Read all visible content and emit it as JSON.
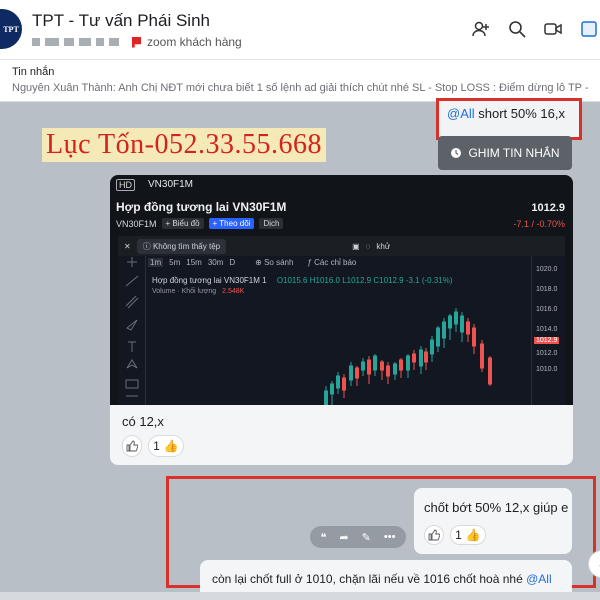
{
  "header": {
    "avatar_text": "TPT",
    "title": "TPT - Tư vấn Phái Sinh",
    "subtitle_tag": "zoom khách hàng"
  },
  "pinned": {
    "label": "Tin nhắn",
    "text": "Nguyễn Xuân Thành: Anh Chị NĐT mới chưa biết 1 số lệnh ad giải thích chút nhé SL - Stop LOSS : Điểm dừng lỗ TP - Take Prof..."
  },
  "watermark": "Lục  Tốn-052.33.55.668",
  "msg_all": {
    "mention": "@All",
    "text": " short 50% 16,x"
  },
  "ghim_button": "GHIM TIN NHẮN",
  "shot": {
    "hd": "HD",
    "symbol": "VN30F1M",
    "name": "Hợp đồng tương lai VN30F1M",
    "price": "1012.9",
    "code": "VN30F1M",
    "btn_chart": "+ Biểu đồ",
    "btn_follow": "+ Theo dõi",
    "btn_translate": "Dịch",
    "change": "-7.1 / -0.70%",
    "tooltip": "Không tìm thấy tệp",
    "extra": "khử",
    "timeframes": [
      "1m",
      "5m",
      "15m",
      "30m",
      "D"
    ],
    "compare": "So sánh",
    "indicators": "Các chỉ báo",
    "info_line": "Hợp đồng tương lai VN30F1M  1",
    "ohlc": "O1015.6 H1016.0 L1012.9 C1012.9 -3.1 (-0.31%)",
    "volume_label": "Volume · Khối lượng",
    "volume_value": "2.548K",
    "yticks": [
      "1020.0",
      "1018.0",
      "1016.0",
      "1014.0",
      "1012.9",
      "1012.0",
      "1010.0"
    ]
  },
  "card_caption": "có 12,x",
  "reaction1": {
    "count": "1"
  },
  "bubble1": {
    "text": "chốt bớt 50% 12,x giúp e",
    "count": "1"
  },
  "bubble2": {
    "text": "còn lại chốt full ở 1010, chặn lãi nếu về 1016 chốt hoà nhé ",
    "mention": "@All"
  },
  "colors": {
    "accent": "#1f6fd8",
    "highlight": "#d9302a",
    "up": "#26a69a",
    "down": "#ef5350"
  }
}
